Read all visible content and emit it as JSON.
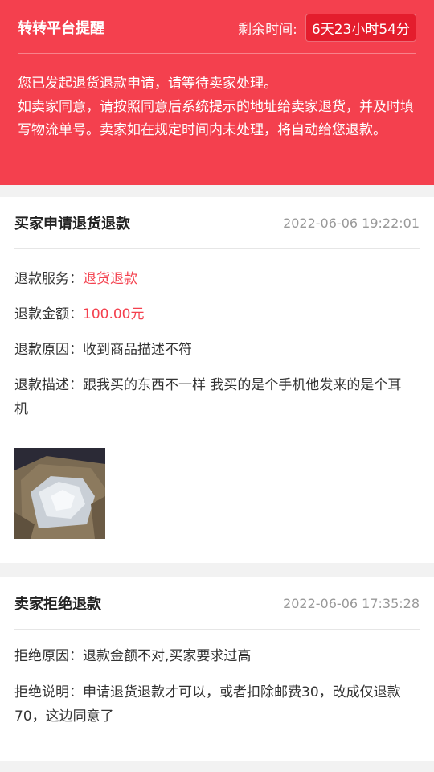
{
  "banner": {
    "title": "转转平台提醒",
    "time_label": "剩余时间:",
    "time_value": "6天23小时54分",
    "message_1": "您已发起退货退款申请，请等待卖家处理。",
    "message_2": "如卖家同意，请按照同意后系统提示的地址给卖家退货，并及时填写物流单号。卖家如在规定时间内未处理，将自动给您退款。"
  },
  "buyer_request": {
    "title": "买家申请退货退款",
    "time": "2022-06-06 19:22:01",
    "service_label": "退款服务：",
    "service_value": "退货退款",
    "amount_label": "退款金额：",
    "amount_value": "100.00元",
    "reason_label": "退款原因：",
    "reason_value": "收到商品描述不符",
    "desc_label": "退款描述：",
    "desc_value": "跟我买的东西不一样 我买的是个手机他发来的是个耳机"
  },
  "seller_reject": {
    "title": "卖家拒绝退款",
    "time": "2022-06-06 17:35:28",
    "reason_label": "拒绝原因：",
    "reason_value": "退款金额不对,买家要求过高",
    "desc_label": "拒绝说明：",
    "desc_value": "申请退货退款才可以，或者扣除邮费30，改成仅退款70，这边同意了"
  },
  "colors": {
    "accent": "#f4404e",
    "badge": "#e41d2d",
    "muted": "#999999"
  }
}
